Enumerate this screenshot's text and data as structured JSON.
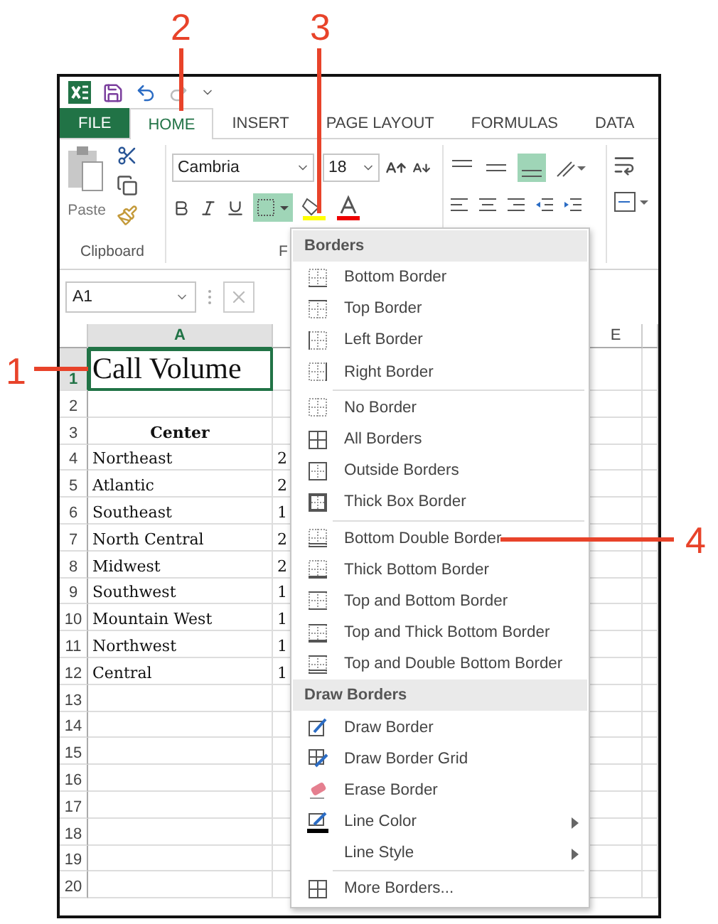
{
  "tabs": [
    {
      "label": "FILE",
      "kind": "file",
      "selected": false
    },
    {
      "label": "HOME",
      "kind": "tab",
      "selected": true
    },
    {
      "label": "INSERT",
      "kind": "tab",
      "selected": false
    },
    {
      "label": "PAGE LAYOUT",
      "kind": "tab",
      "selected": false
    },
    {
      "label": "FORMULAS",
      "kind": "tab",
      "selected": false
    },
    {
      "label": "DATA",
      "kind": "tab",
      "selected": false
    }
  ],
  "ribbon": {
    "paste_label": "Paste",
    "font_name": "Cambria",
    "font_size": "18",
    "group_labels": [
      "Clipboard",
      "F"
    ]
  },
  "name_box": "A1",
  "columns": [
    {
      "label": "A",
      "selected": true
    },
    {
      "label": "E",
      "selected": false
    }
  ],
  "rows": [
    {
      "number": "1",
      "selected": true,
      "kind": "title",
      "column_1": "Call Volume"
    },
    {
      "number": "2",
      "selected": false,
      "kind": "data"
    },
    {
      "number": "3",
      "selected": false,
      "kind": "header",
      "column_1": "Center"
    },
    {
      "number": "4",
      "selected": false,
      "kind": "data",
      "column_1": "Northeast",
      "column_2": "2"
    },
    {
      "number": "5",
      "selected": false,
      "kind": "data",
      "column_1": "Atlantic",
      "column_2": "2"
    },
    {
      "number": "6",
      "selected": false,
      "kind": "data",
      "column_1": "Southeast",
      "column_2": "1"
    },
    {
      "number": "7",
      "selected": false,
      "kind": "data",
      "column_1": "North Central",
      "column_2": "2"
    },
    {
      "number": "8",
      "selected": false,
      "kind": "data",
      "column_1": "Midwest",
      "column_2": "2"
    },
    {
      "number": "9",
      "selected": false,
      "kind": "data",
      "column_1": "Southwest",
      "column_2": "1"
    },
    {
      "number": "10",
      "selected": false,
      "kind": "data",
      "column_1": "Mountain West",
      "column_2": "1"
    },
    {
      "number": "11",
      "selected": false,
      "kind": "data",
      "column_1": "Northwest",
      "column_2": "1"
    },
    {
      "number": "12",
      "selected": false,
      "kind": "data",
      "column_1": "Central",
      "column_2": "1"
    },
    {
      "number": "13",
      "selected": false,
      "kind": "data"
    },
    {
      "number": "14",
      "selected": false,
      "kind": "data"
    },
    {
      "number": "15",
      "selected": false,
      "kind": "data"
    },
    {
      "number": "16",
      "selected": false,
      "kind": "data"
    },
    {
      "number": "17",
      "selected": false,
      "kind": "data"
    },
    {
      "number": "18",
      "selected": false,
      "kind": "data"
    },
    {
      "number": "19",
      "selected": false,
      "kind": "data"
    },
    {
      "number": "20",
      "selected": false,
      "kind": "data"
    }
  ],
  "menu": {
    "sections": [
      {
        "title": "Borders",
        "groups": [
          [
            {
              "label": "Bottom Border",
              "kind": "bottom"
            },
            {
              "label": "Top Border",
              "kind": "top"
            },
            {
              "label": "Left Border",
              "kind": "left"
            },
            {
              "label": "Right Border",
              "kind": "right"
            }
          ],
          [
            {
              "label": "No Border",
              "kind": "none"
            },
            {
              "label": "All Borders",
              "kind": "all"
            },
            {
              "label": "Outside Borders",
              "kind": "outside"
            },
            {
              "label": "Thick Box Border",
              "kind": "thickbox"
            }
          ],
          [
            {
              "label": "Bottom Double Border",
              "kind": "bottomdouble"
            },
            {
              "label": "Thick Bottom Border",
              "kind": "thickbottom"
            },
            {
              "label": "Top and Bottom Border",
              "kind": "topbottom"
            },
            {
              "label": "Top and Thick Bottom Border",
              "kind": "topthickbottom"
            },
            {
              "label": "Top and Double Bottom Border",
              "kind": "topdoublebottom"
            }
          ]
        ]
      },
      {
        "title": "Draw Borders",
        "groups": [
          [
            {
              "label": "Draw Border",
              "kind": "draw"
            },
            {
              "label": "Draw Border Grid",
              "kind": "drawgrid"
            },
            {
              "label": "Erase Border",
              "kind": "erase"
            },
            {
              "label": "Line Color",
              "kind": "linecolor",
              "submenu": true
            },
            {
              "label": "Line Style",
              "kind": "blank",
              "submenu": true
            }
          ],
          [
            {
              "label": "More Borders...",
              "kind": "all"
            }
          ]
        ]
      }
    ]
  },
  "callouts": [
    {
      "label": "1"
    },
    {
      "label": "2"
    },
    {
      "label": "3"
    },
    {
      "label": "4"
    }
  ]
}
